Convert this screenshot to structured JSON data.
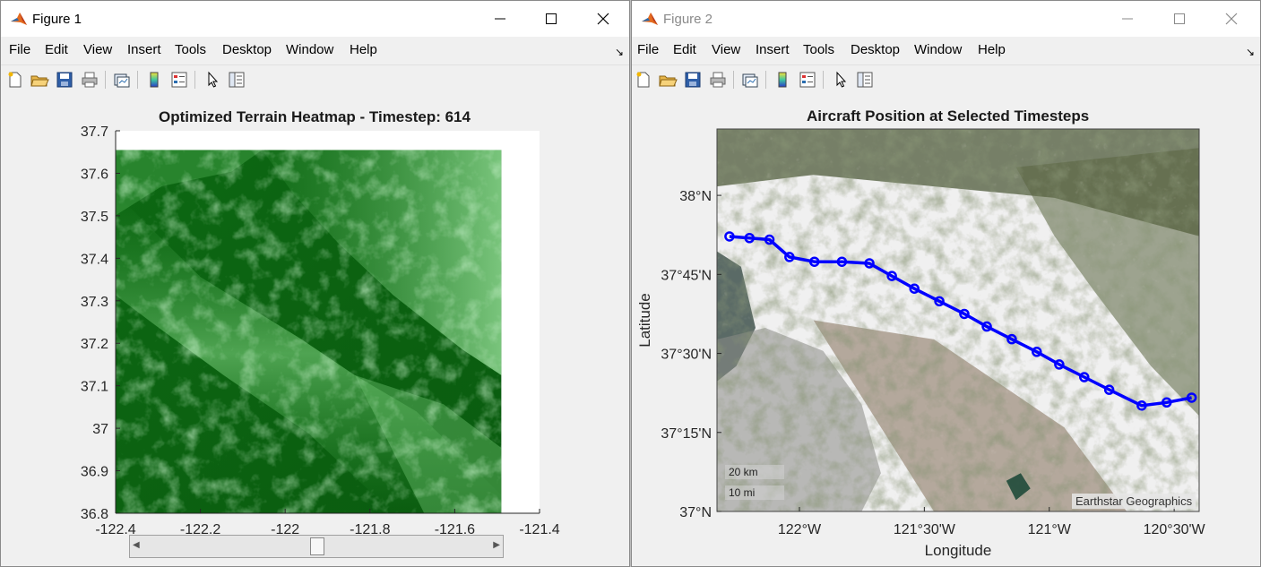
{
  "colors": {
    "window_bg": "#f0f0f0",
    "terrain_dark": "#0b5e10",
    "terrain_light": "#8fdc91",
    "route": "#0000ff"
  },
  "menu_items": [
    "File",
    "Edit",
    "View",
    "Insert",
    "Tools",
    "Desktop",
    "Window",
    "Help"
  ],
  "toolbar_icons": [
    "new-figure-icon",
    "open-file-icon",
    "save-icon",
    "print-icon",
    "link-plot-icon",
    "colorbar-icon",
    "legend-icon",
    "pointer-icon",
    "property-inspector-icon"
  ],
  "figure1": {
    "title": "Figure 1",
    "plot_title": "Optimized Terrain Heatmap - Timestep: 614",
    "slider_value": 0.5
  },
  "figure2": {
    "title": "Figure 2",
    "plot_title": "Aircraft Position at Selected Timesteps",
    "scale_km": "20 km",
    "scale_mi": "10 mi",
    "attribution": "Earthstar Geographics"
  },
  "chart_data": [
    {
      "type": "heatmap",
      "title": "Optimized Terrain Heatmap - Timestep: 614",
      "xlabel": "",
      "ylabel": "",
      "xlim": [
        -122.4,
        -121.4
      ],
      "ylim": [
        36.8,
        37.7
      ],
      "x_ticks": [
        -122.4,
        -122.2,
        -122,
        -121.8,
        -121.6,
        -121.4
      ],
      "y_ticks": [
        36.8,
        36.9,
        37,
        37.1,
        37.2,
        37.3,
        37.4,
        37.5,
        37.6,
        37.7
      ],
      "x_tick_labels": [
        "-122.4",
        "-122.2",
        "-122",
        "-121.8",
        "-121.6",
        "-121.4"
      ],
      "y_tick_labels": [
        "36.8",
        "36.9",
        "37",
        "37.1",
        "37.2",
        "37.3",
        "37.4",
        "37.5",
        "37.6",
        "37.7"
      ],
      "data_extent": {
        "x": [
          -122.4,
          -121.49
        ],
        "y": [
          36.8,
          37.655
        ]
      },
      "grid": false
    },
    {
      "type": "line",
      "title": "Aircraft Position at Selected Timesteps",
      "xlabel": "Longitude",
      "ylabel": "Latitude",
      "xlim": [
        -122.33,
        -120.4
      ],
      "ylim": [
        37.0,
        38.21
      ],
      "x_ticks": [
        -122,
        -121.5,
        -121,
        -120.5
      ],
      "y_ticks": [
        37.0,
        37.25,
        37.5,
        37.75,
        38.0
      ],
      "x_tick_labels": [
        "122°W",
        "121°30'W",
        "121°W",
        "120°30'W"
      ],
      "y_tick_labels": [
        "37°N",
        "37°15'N",
        "37°30'N",
        "37°45'N",
        "38°N"
      ],
      "series": [
        {
          "marker": "circle",
          "x": [
            -122.28,
            -122.2,
            -122.12,
            -122.04,
            -121.94,
            -121.83,
            -121.72,
            -121.63,
            -121.54,
            -121.44,
            -121.34,
            -121.25,
            -121.15,
            -121.05,
            -120.96,
            -120.86,
            -120.76,
            -120.63,
            -120.53,
            -120.43
          ],
          "y": [
            37.87,
            37.865,
            37.86,
            37.805,
            37.79,
            37.79,
            37.785,
            37.745,
            37.705,
            37.665,
            37.625,
            37.585,
            37.545,
            37.505,
            37.465,
            37.425,
            37.385,
            37.335,
            37.345,
            37.36
          ]
        }
      ],
      "grid": false
    }
  ]
}
